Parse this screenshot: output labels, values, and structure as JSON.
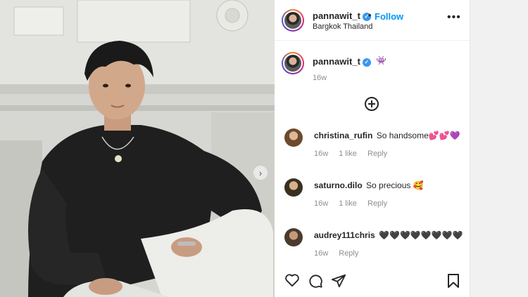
{
  "post": {
    "author": {
      "username": "pannawit_t",
      "location": "Bargkok Thailand",
      "follow_label": "Follow",
      "separator": "•"
    },
    "more_label": "•••",
    "caption": {
      "username": "pannawit_t",
      "emoji": "👾",
      "time": "16w"
    },
    "carousel_next": "›"
  },
  "comments": [
    {
      "username": "christina_rufin",
      "text": "So handsome💕💕💜",
      "time": "16w",
      "likes": "1 like",
      "reply": "Reply"
    },
    {
      "username": "saturno.dilo",
      "text": "So precious 🥰",
      "time": "16w",
      "likes": "1 like",
      "reply": "Reply"
    },
    {
      "username": "audrey111chris",
      "text": "🖤🖤🖤🖤🖤🖤🖤🖤",
      "time": "16w",
      "likes": "",
      "reply": "Reply"
    }
  ],
  "icons": {
    "verified": "verified-badge-icon",
    "add": "add-circle-icon",
    "like": "heart-icon",
    "comment": "comment-icon",
    "share": "send-icon",
    "save": "bookmark-icon"
  },
  "colors": {
    "link_blue": "#0095f6",
    "verified_blue": "#3897f0",
    "meta_gray": "#8e8e8e"
  }
}
